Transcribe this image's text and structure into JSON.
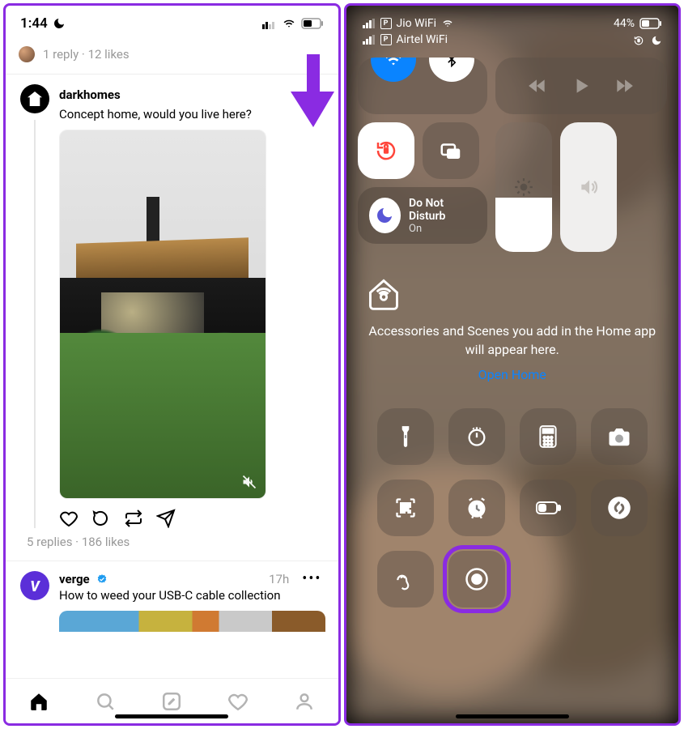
{
  "left": {
    "status": {
      "time": "1:44"
    },
    "prev": {
      "engagement": "1 reply · 12 likes"
    },
    "post1": {
      "author": "darkhomes",
      "text": "Concept home, would you live here?",
      "engagement": "5 replies · 186 likes"
    },
    "post2": {
      "author": "verge",
      "time": "17h",
      "text": "How to weed your USB-C cable collection"
    }
  },
  "right": {
    "status": {
      "net1": "Jio WiFi",
      "net2": "Airtel WiFi",
      "battery": "44%"
    },
    "focus": {
      "title": "Do Not Disturb",
      "state": "On"
    },
    "home": {
      "message": "Accessories and Scenes you add in the Home app will appear here.",
      "link": "Open Home"
    }
  }
}
